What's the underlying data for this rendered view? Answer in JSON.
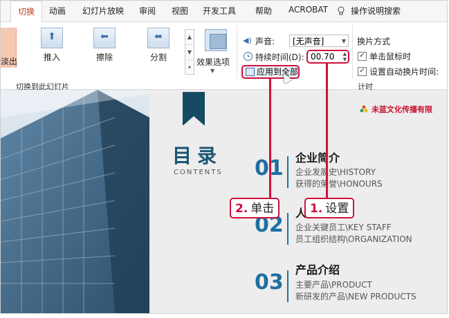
{
  "ribbon_tabs": [
    "切换",
    "动画",
    "幻灯片放映",
    "审阅",
    "视图",
    "开发工具",
    "帮助",
    "ACROBAT",
    "操作说明搜索"
  ],
  "transitions": {
    "partial_label": "淡出",
    "buttons": [
      {
        "label": "推入",
        "icon": "push-arrow-up-icon"
      },
      {
        "label": "擦除",
        "icon": "wipe-arrow-left-icon"
      },
      {
        "label": "分割",
        "icon": "split-arrows-icon"
      }
    ],
    "effect_options": "效果选项",
    "group_label": "切换到此幻灯片"
  },
  "timing": {
    "sound_label": "声音:",
    "sound_value": "[无声音]",
    "duration_label": "持续时间(D):",
    "duration_value": "00.70",
    "apply_all": "应用到全部",
    "advance_title": "换片方式",
    "on_click": "单击鼠标时",
    "auto_advance": "设置自动换片时间:",
    "group_label": "计时"
  },
  "slide": {
    "heading": "目录",
    "subheading": "CONTENTS",
    "brand": "未蓝文化传播有限",
    "sections": [
      {
        "number": "01",
        "title": "企业简介",
        "lines": [
          "企业发展史\\HISTORY",
          "获得的荣誉\\HONOURS"
        ]
      },
      {
        "number": "02",
        "title": "人员介绍",
        "lines": [
          "企业关键员工\\KEY STAFF",
          "员工组织结构\\ORGANIZATION"
        ]
      },
      {
        "number": "03",
        "title": "产品介绍",
        "lines": [
          "主要产品\\PRODUCT",
          "新研发的产品\\NEW PRODUCTS"
        ]
      }
    ]
  },
  "annotations": {
    "step1": {
      "num": "1.",
      "text": "设置"
    },
    "step2": {
      "num": "2.",
      "text": "单击"
    }
  },
  "colors": {
    "accent_tab": "#c43e1c",
    "annotation": "#d0103a",
    "slide_blue": "#1f6fa0"
  }
}
